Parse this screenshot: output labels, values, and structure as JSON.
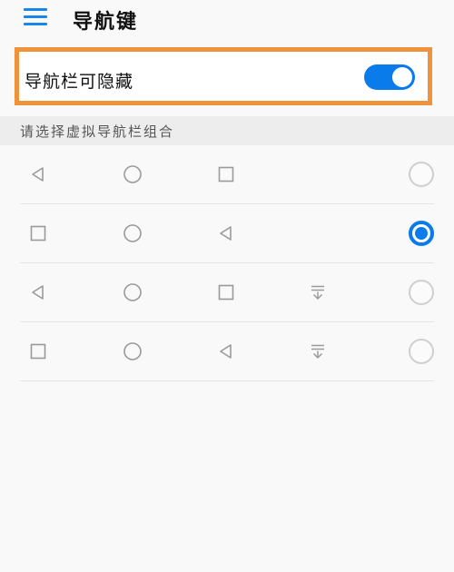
{
  "header": {
    "title": "导航键",
    "menu_icon": "hamburger-menu-icon"
  },
  "toggle": {
    "label": "导航栏可隐藏",
    "state": "on",
    "color": "#0a7bea",
    "highlight_color": "#f0923c"
  },
  "section": {
    "label": "请选择虚拟导航栏组合"
  },
  "options": [
    {
      "icons": [
        "back-triangle-icon",
        "home-circle-icon",
        "recents-square-icon"
      ],
      "selected": false
    },
    {
      "icons": [
        "recents-square-icon",
        "home-circle-icon",
        "back-triangle-icon"
      ],
      "selected": true
    },
    {
      "icons": [
        "back-triangle-icon",
        "home-circle-icon",
        "recents-square-icon",
        "notification-pulldown-icon"
      ],
      "selected": false
    },
    {
      "icons": [
        "recents-square-icon",
        "home-circle-icon",
        "back-triangle-icon",
        "notification-pulldown-icon"
      ],
      "selected": false
    }
  ]
}
